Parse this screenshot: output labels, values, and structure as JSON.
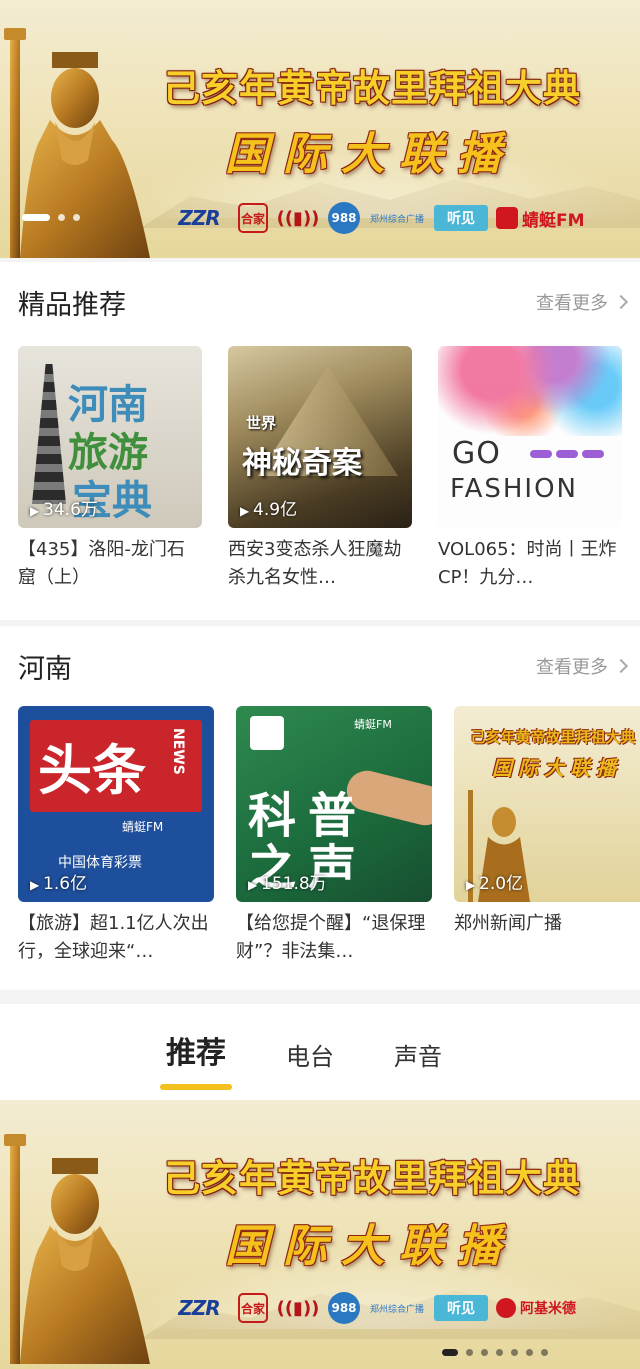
{
  "banner": {
    "title": "己亥年黄帝故里拜祖大典",
    "subtitle": "国际大联播",
    "logos": [
      "ZZR",
      "合家",
      "郑州广播",
      "988",
      "郑州综合广播",
      "听见",
      "蜻蜓FM"
    ]
  },
  "banner_bottom": {
    "logos": [
      "ZZR",
      "合家",
      "郑州广播",
      "988",
      "郑州综合广播",
      "听见",
      "阿基米德"
    ]
  },
  "sections": [
    {
      "title": "精品推荐",
      "more_label": "查看更多",
      "items": [
        {
          "thumb_text": [
            "河南",
            "旅游",
            "宝典"
          ],
          "plays": "34.6万",
          "text": "【435】洛阳-龙门石窟（上）"
        },
        {
          "thumb_text": [
            "世界",
            "神秘奇案"
          ],
          "plays": "4.9亿",
          "text": "西安3变态杀人狂魔劫杀九名女性…"
        },
        {
          "thumb_text": [
            "GO",
            "FASHION"
          ],
          "plays": "",
          "text": "VOL065：时尚丨王炸CP！九分…"
        }
      ]
    },
    {
      "title": "河南",
      "more_label": "查看更多",
      "items": [
        {
          "thumb_text": [
            "头条",
            "NEWS",
            "蜻蜓FM",
            "中国体育彩票"
          ],
          "plays": "1.6亿",
          "text": "【旅游】超1.1亿人次出行，全球迎来“…"
        },
        {
          "thumb_text": [
            "科",
            "普",
            "之",
            "声",
            "蜻蜓FM"
          ],
          "plays": "151.8万",
          "text": "【给您提个醒】“退保理财”？非法集…"
        },
        {
          "thumb_text": [
            "己亥年黄帝故里拜祖大典",
            "国际大联播"
          ],
          "plays": "2.0亿",
          "text": "郑州新闻广播"
        }
      ]
    }
  ],
  "tabs": {
    "items": [
      "推荐",
      "电台",
      "声音"
    ],
    "active": "推荐"
  },
  "colors": {
    "accent": "#f4c01e",
    "banner_title": "#f7cf2a",
    "banner_outline": "#8c2410"
  }
}
